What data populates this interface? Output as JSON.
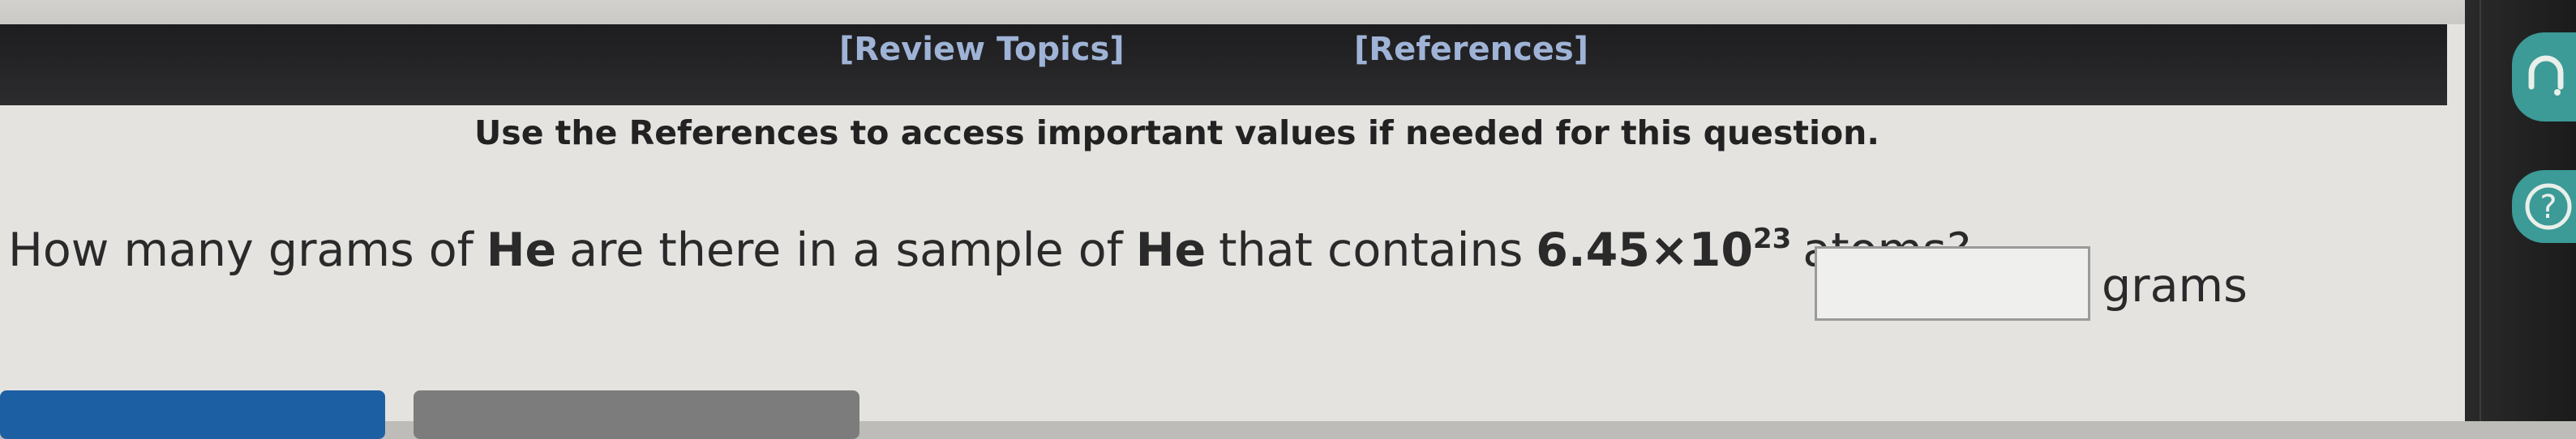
{
  "links": {
    "review_topics": "[Review Topics]",
    "references": "[References]"
  },
  "notice": "Use the References to access important values if needed for this question.",
  "question": {
    "part1": "How many grams of",
    "element1": "He",
    "part2": "are there in a sample of",
    "element2": "He",
    "part3": "that contains",
    "mantissa": "6.45×10",
    "exponent": "23",
    "part4": "atoms?"
  },
  "answer": {
    "value": "",
    "unit": "grams"
  },
  "icons": {
    "rail_top": "headset-icon",
    "rail_help": "help-icon"
  },
  "colors": {
    "link_bar": "#1d1d1f",
    "link_text": "#9fb3d6",
    "primary_button": "#1d5fa3",
    "secondary_button": "#7c7c7c",
    "rail_accent": "#3c9a97"
  }
}
